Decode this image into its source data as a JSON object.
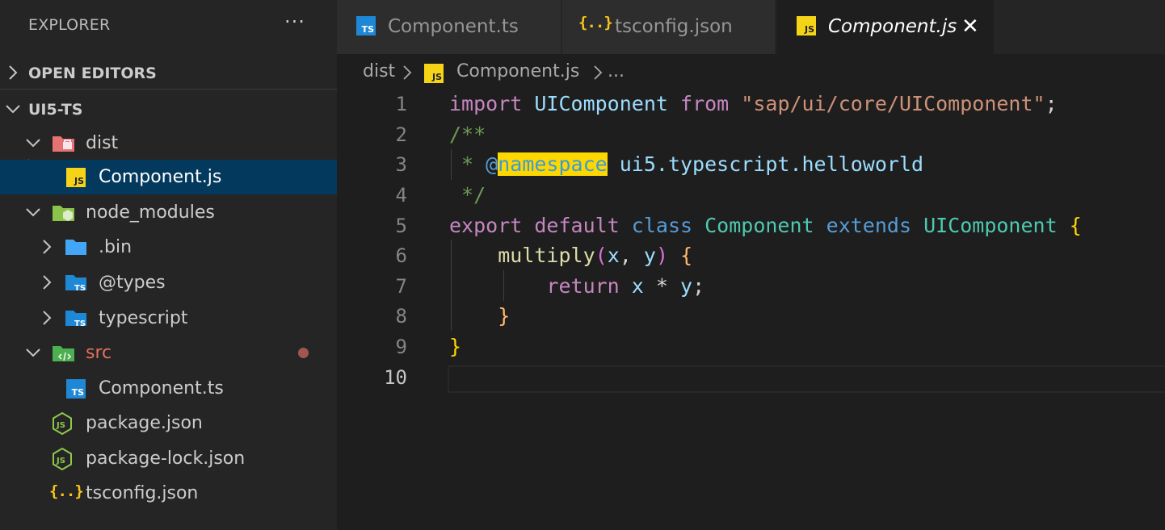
{
  "sidebar": {
    "title": "EXPLORER",
    "more": "···",
    "sections": {
      "open_editors": "OPEN EDITORS",
      "project": "UI5-TS"
    },
    "tree": [
      {
        "label": "dist",
        "icon": "folder-dist-open-icon",
        "expanded": true
      },
      {
        "label": "Component.js",
        "icon": "js-file-icon",
        "selected": true
      },
      {
        "label": "node_modules",
        "icon": "folder-node-open-icon",
        "expanded": true
      },
      {
        "label": ".bin",
        "icon": "folder-icon",
        "expanded": false
      },
      {
        "label": "@types",
        "icon": "folder-typescript-icon",
        "expanded": false
      },
      {
        "label": "typescript",
        "icon": "folder-typescript-icon",
        "expanded": false
      },
      {
        "label": "src",
        "icon": "folder-src-open-icon",
        "expanded": true,
        "modified": true
      },
      {
        "label": "Component.ts",
        "icon": "ts-file-icon"
      },
      {
        "label": "package.json",
        "icon": "nodejs-file-icon"
      },
      {
        "label": "package-lock.json",
        "icon": "nodejs-file-icon"
      },
      {
        "label": "tsconfig.json",
        "icon": "json-file-icon"
      }
    ]
  },
  "tabs": [
    {
      "label": "Component.ts",
      "icon": "ts-file-icon",
      "active": false
    },
    {
      "label": "tsconfig.json",
      "icon": "json-file-icon",
      "active": false
    },
    {
      "label": "Component.js",
      "icon": "js-file-icon",
      "active": true,
      "close": "✕"
    }
  ],
  "breadcrumb": {
    "folder": "dist",
    "file": "Component.js",
    "more": "..."
  },
  "editor": {
    "line_numbers": [
      "1",
      "2",
      "3",
      "4",
      "5",
      "6",
      "7",
      "8",
      "9",
      "10"
    ],
    "line1": {
      "import": "import",
      "name": "UIComponent",
      "from": "from",
      "path": "\"sap/ui/core/UIComponent\"",
      "semi": ";"
    },
    "line2": "/**",
    "line3": {
      "star": " * ",
      "at": "@",
      "tag": "namespace",
      "ns": " ui5.typescript.helloworld"
    },
    "line4": " */",
    "line5": {
      "export": "export",
      "default": "default",
      "class": "class",
      "name": "Component",
      "extends": "extends",
      "base": "UIComponent",
      "brace": "{"
    },
    "line6": {
      "fn": "multiply",
      "open": "(",
      "x": "x",
      "comma": ", ",
      "y": "y",
      "close": ")",
      "brace": "{"
    },
    "line7": {
      "ret": "return",
      "x": "x",
      "op": " * ",
      "y": "y",
      "semi": ";"
    },
    "line8": "}",
    "line9": "}"
  },
  "colors": {
    "editor_bg": "#1e1e1e",
    "sidebar_bg": "#252526",
    "selection": "#04395e",
    "keyword_control": "#c586c0",
    "keyword": "#569cd6",
    "class_name": "#4ec9b0",
    "string": "#ce9178",
    "comment": "#6a9955",
    "function": "#dcdcaa",
    "highlight": "#ffd700"
  }
}
